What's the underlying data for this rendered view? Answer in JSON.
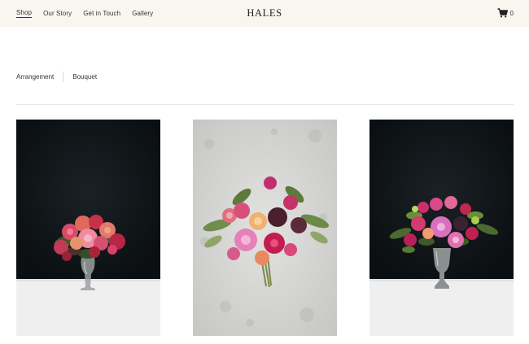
{
  "header": {
    "nav": [
      {
        "label": "Shop"
      },
      {
        "label": "Our Story"
      },
      {
        "label": "Get in Touch"
      },
      {
        "label": "Gallery"
      }
    ],
    "logo": "HALES",
    "cart_count": "0",
    "cart_icon": "cart-icon"
  },
  "filters": [
    {
      "label": "Arrangement"
    },
    {
      "label": "Bouquet"
    }
  ],
  "products": [
    {
      "image": "flower-arrangement-glass-vase-dark-background"
    },
    {
      "image": "bouquet-on-grey-concrete"
    },
    {
      "image": "flower-arrangement-silver-urn-dark-background"
    }
  ],
  "colors": {
    "header_bg": "#f8f6ef",
    "photo_dark": "#0d1114",
    "table_white": "#efefef",
    "concrete": "#d6d6d4",
    "rose_pink": "#d0386a",
    "magenta": "#c21c5c",
    "peach": "#e8906a",
    "leaf_green": "#5b7a3e"
  }
}
